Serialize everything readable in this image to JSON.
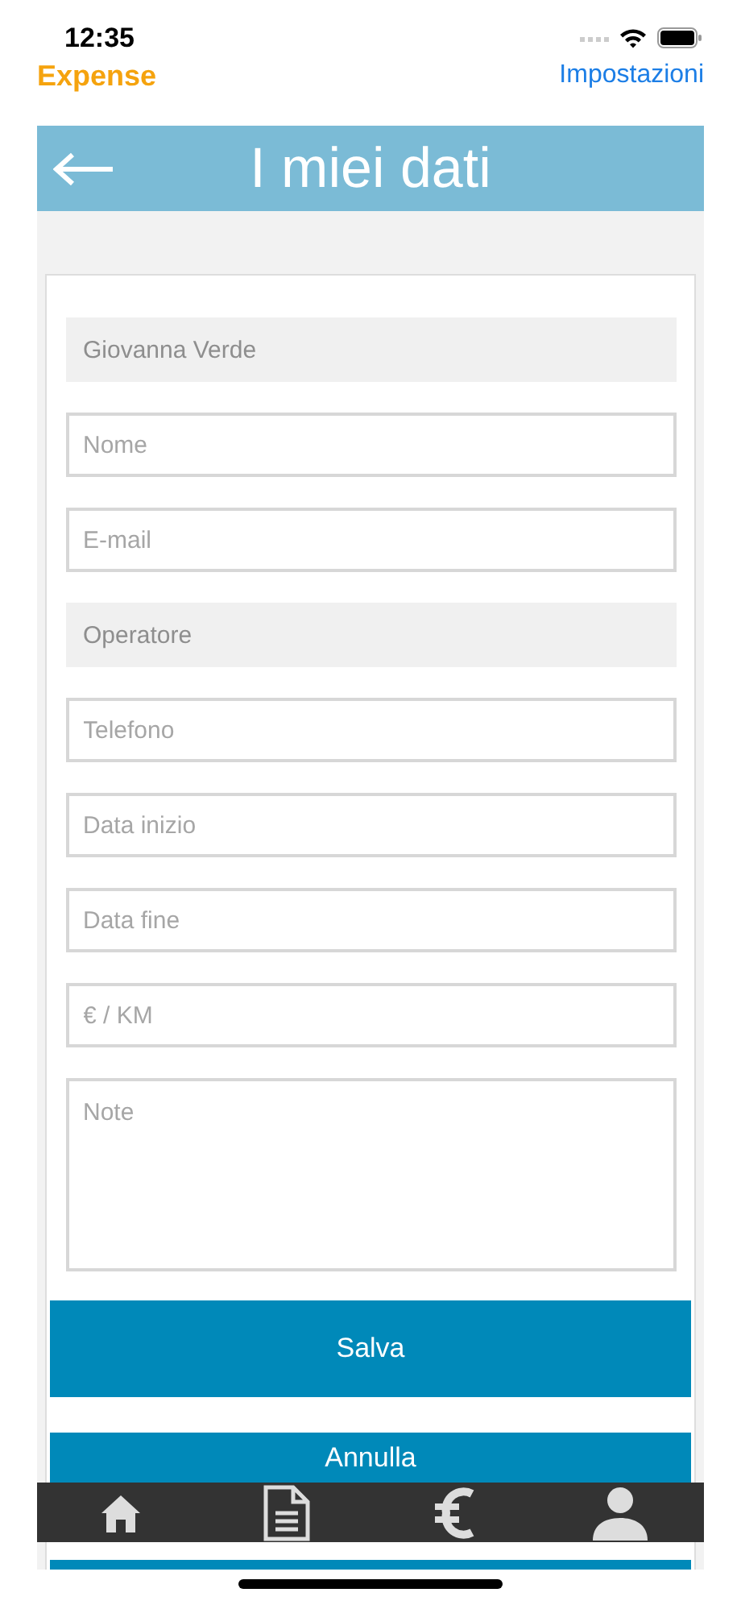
{
  "status_bar": {
    "time": "12:35"
  },
  "nav": {
    "back_app": "Expense",
    "settings_link": "Impostazioni"
  },
  "header": {
    "title": "I miei dati"
  },
  "form": {
    "fields": [
      {
        "kind": "input",
        "value": "Giovanna Verde",
        "disabled": true
      },
      {
        "kind": "input",
        "placeholder": "Nome",
        "disabled": false
      },
      {
        "kind": "input",
        "placeholder": "E-mail",
        "disabled": false
      },
      {
        "kind": "input",
        "placeholder": "Operatore",
        "disabled": true
      },
      {
        "kind": "input",
        "placeholder": "Telefono",
        "disabled": false
      },
      {
        "kind": "input",
        "placeholder": "Data inizio",
        "disabled": false
      },
      {
        "kind": "input",
        "placeholder": "Data fine",
        "disabled": false
      },
      {
        "kind": "input",
        "placeholder": "€ / KM",
        "disabled": false
      },
      {
        "kind": "textarea",
        "placeholder": "Note",
        "disabled": false
      }
    ],
    "buttons": [
      "Salva",
      "Annulla"
    ]
  },
  "tab_bar": {
    "tabs": [
      {
        "kind": "home"
      },
      {
        "kind": "document"
      },
      {
        "kind": "euro"
      },
      {
        "kind": "person"
      }
    ]
  }
}
